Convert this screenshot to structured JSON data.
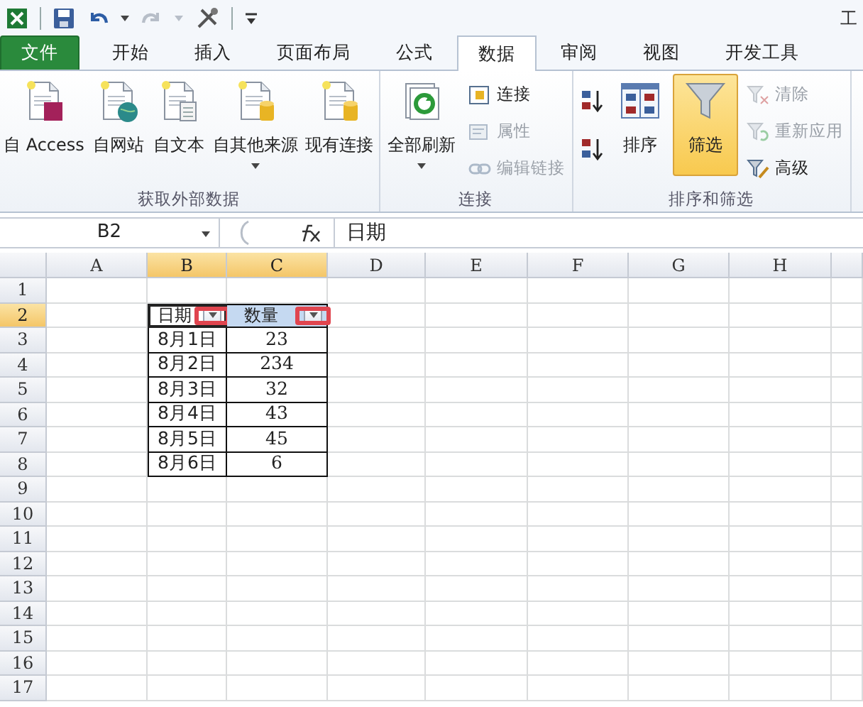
{
  "window": {
    "title": "工"
  },
  "tabs": [
    {
      "label": "文件",
      "kind": "file",
      "selected": false
    },
    {
      "label": "开始",
      "kind": "tab",
      "selected": false
    },
    {
      "label": "插入",
      "kind": "tab",
      "selected": false
    },
    {
      "label": "页面布局",
      "kind": "tab",
      "selected": false
    },
    {
      "label": "公式",
      "kind": "tab",
      "selected": false
    },
    {
      "label": "数据",
      "kind": "tab",
      "selected": true
    },
    {
      "label": "审阅",
      "kind": "tab",
      "selected": false
    },
    {
      "label": "视图",
      "kind": "tab",
      "selected": false
    },
    {
      "label": "开发工具",
      "kind": "tab",
      "selected": false
    }
  ],
  "ribbon": {
    "groups": [
      {
        "label": "获取外部数据",
        "items": [
          {
            "kind": "large",
            "label": "自 Access",
            "disabled": false,
            "selected": false
          },
          {
            "kind": "large",
            "label": "自网站",
            "disabled": false,
            "selected": false
          },
          {
            "kind": "large",
            "label": "自文本",
            "disabled": false,
            "selected": false
          },
          {
            "kind": "large",
            "label": "自其他来源",
            "disabled": false,
            "selected": false,
            "dropdown": true
          },
          {
            "kind": "large",
            "label": "现有连接",
            "disabled": false,
            "selected": false
          }
        ]
      },
      {
        "label": "连接",
        "items": [
          {
            "kind": "large",
            "label": "全部刷新",
            "disabled": false,
            "selected": false,
            "dropdown": true
          },
          {
            "kind": "small",
            "label": "连接",
            "disabled": false
          },
          {
            "kind": "small",
            "label": "属性",
            "disabled": true
          },
          {
            "kind": "small",
            "label": "编辑链接",
            "disabled": true
          }
        ]
      },
      {
        "label": "排序和筛选",
        "items": [
          {
            "kind": "icon",
            "disabled": false
          },
          {
            "kind": "icon",
            "disabled": false
          },
          {
            "kind": "large",
            "label": "排序",
            "disabled": false,
            "selected": false
          },
          {
            "kind": "large",
            "label": "筛选",
            "disabled": false,
            "selected": true
          },
          {
            "kind": "small",
            "label": "清除",
            "disabled": true
          },
          {
            "kind": "small",
            "label": "重新应用",
            "disabled": true
          },
          {
            "kind": "small",
            "label": "高级",
            "disabled": false
          }
        ]
      }
    ]
  },
  "formula_bar": {
    "name_box": "B2",
    "formula": "日期"
  },
  "sheet": {
    "columns": [
      {
        "label": "A",
        "selected": false
      },
      {
        "label": "B",
        "selected": true
      },
      {
        "label": "C",
        "selected": true
      },
      {
        "label": "D",
        "selected": false
      },
      {
        "label": "E",
        "selected": false
      },
      {
        "label": "F",
        "selected": false
      },
      {
        "label": "G",
        "selected": false
      },
      {
        "label": "H",
        "selected": false
      }
    ],
    "rows": [
      {
        "label": "1",
        "selected": false
      },
      {
        "label": "2",
        "selected": true
      },
      {
        "label": "3",
        "selected": false
      },
      {
        "label": "4",
        "selected": false
      },
      {
        "label": "5",
        "selected": false
      },
      {
        "label": "6",
        "selected": false
      },
      {
        "label": "7",
        "selected": false
      },
      {
        "label": "8",
        "selected": false
      },
      {
        "label": "9",
        "selected": false
      },
      {
        "label": "10",
        "selected": false
      },
      {
        "label": "11",
        "selected": false
      },
      {
        "label": "12",
        "selected": false
      },
      {
        "label": "13",
        "selected": false
      },
      {
        "label": "14",
        "selected": false
      },
      {
        "label": "15",
        "selected": false
      },
      {
        "label": "16",
        "selected": false
      },
      {
        "label": "17",
        "selected": false
      }
    ],
    "table": {
      "header": [
        {
          "text": "日期",
          "active": true,
          "filter": true,
          "highlighted": true
        },
        {
          "text": "数量",
          "active": false,
          "selected": true,
          "filter": true,
          "highlighted": true
        }
      ],
      "rows": [
        [
          "8月1日",
          "23"
        ],
        [
          "8月2日",
          "234"
        ],
        [
          "8月3日",
          "32"
        ],
        [
          "8月4日",
          "43"
        ],
        [
          "8月5日",
          "45"
        ],
        [
          "8月6日",
          "6"
        ]
      ]
    }
  }
}
